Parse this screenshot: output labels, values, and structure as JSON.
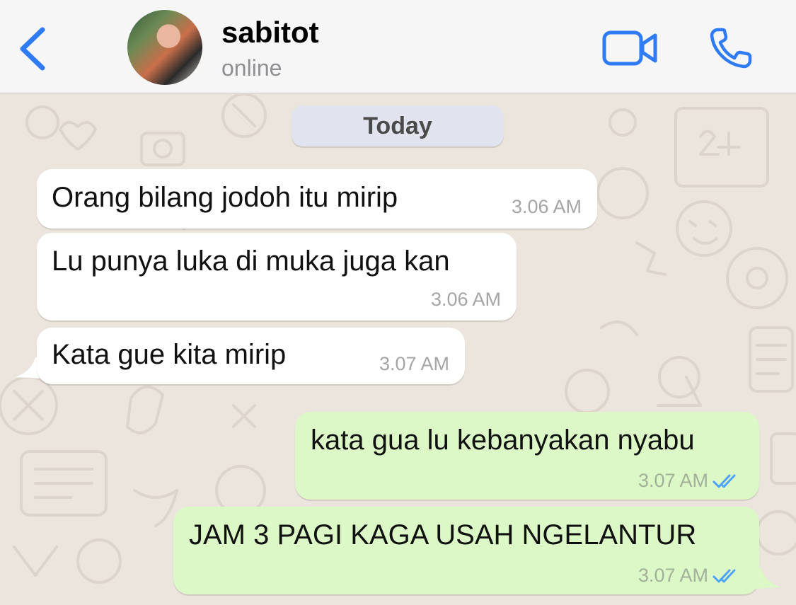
{
  "header": {
    "back_icon": "chevron-left-icon",
    "contact_name": "sabitot",
    "status": "online",
    "video_icon": "video-camera-icon",
    "call_icon": "phone-icon",
    "accent_color": "#2F7BF5"
  },
  "chat": {
    "date_label": "Today",
    "messages": [
      {
        "direction": "incoming",
        "text": "Orang bilang jodoh itu mirip",
        "time": "3.06 AM"
      },
      {
        "direction": "incoming",
        "text": "Lu punya luka di muka juga kan",
        "time": "3.06 AM"
      },
      {
        "direction": "incoming",
        "text": "Kata gue kita mirip",
        "time": "3.07 AM"
      },
      {
        "direction": "outgoing",
        "text": "kata gua lu kebanyakan nyabu",
        "time": "3.07 AM",
        "status": "read"
      },
      {
        "direction": "outgoing",
        "text": "JAM 3 PAGI KAGA USAH NGELANTUR",
        "time": "3.07 AM",
        "status": "read"
      }
    ],
    "incoming_color": "#FFFFFF",
    "outgoing_color": "#DCF8C6",
    "read_tick_color": "#4FA3F7"
  }
}
